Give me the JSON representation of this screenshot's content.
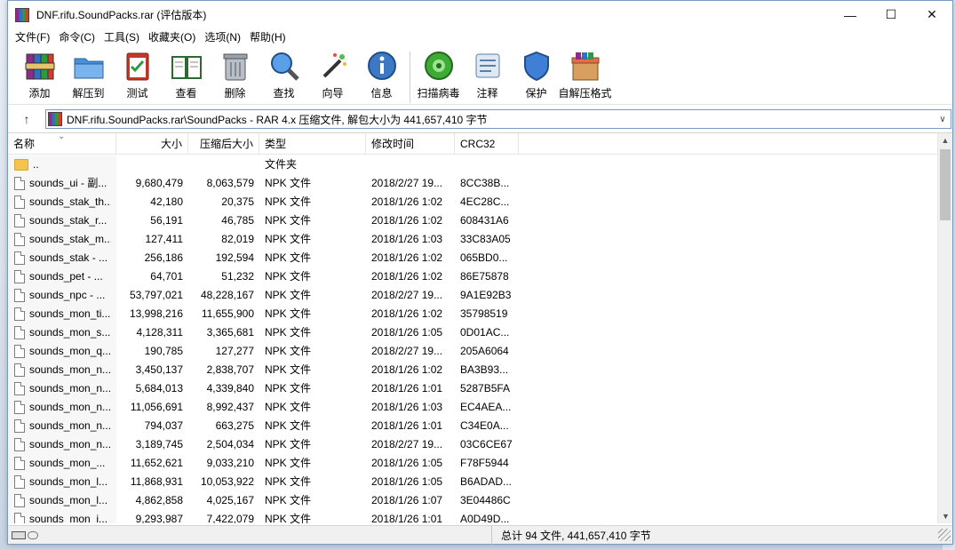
{
  "window": {
    "title": "DNF.rifu.SoundPacks.rar (评估版本)",
    "minimize_glyph": "—",
    "maximize_glyph": "☐",
    "close_glyph": "✕"
  },
  "menu": [
    "文件(F)",
    "命令(C)",
    "工具(S)",
    "收藏夹(O)",
    "选项(N)",
    "帮助(H)"
  ],
  "toolbar": {
    "add": "添加",
    "extract": "解压到",
    "test": "测试",
    "view": "查看",
    "delete": "删除",
    "find": "查找",
    "wizard": "向导",
    "info": "信息",
    "scan": "扫描病毒",
    "comment": "注释",
    "protect": "保护",
    "sfx": "自解压格式"
  },
  "address": {
    "up_glyph": "↑",
    "path": "DNF.rifu.SoundPacks.rar\\SoundPacks - RAR 4.x 压缩文件, 解包大小为 441,657,410 字节",
    "dropdown_glyph": "∨"
  },
  "columns": {
    "name": "名称",
    "size": "大小",
    "packed": "压缩后大小",
    "type": "类型",
    "mtime": "修改时间",
    "crc": "CRC32"
  },
  "rows": [
    {
      "kind": "folder",
      "name": "..",
      "size": "",
      "packed": "",
      "type": "文件夹",
      "mtime": "",
      "crc": ""
    },
    {
      "kind": "file",
      "name": "sounds_ui - 副...",
      "size": "9,680,479",
      "packed": "8,063,579",
      "type": "NPK 文件",
      "mtime": "2018/2/27 19...",
      "crc": "8CC38B..."
    },
    {
      "kind": "file",
      "name": "sounds_stak_th...",
      "size": "42,180",
      "packed": "20,375",
      "type": "NPK 文件",
      "mtime": "2018/1/26 1:02",
      "crc": "4EC28C..."
    },
    {
      "kind": "file",
      "name": "sounds_stak_r...",
      "size": "56,191",
      "packed": "46,785",
      "type": "NPK 文件",
      "mtime": "2018/1/26 1:02",
      "crc": "608431A6"
    },
    {
      "kind": "file",
      "name": "sounds_stak_m...",
      "size": "127,411",
      "packed": "82,019",
      "type": "NPK 文件",
      "mtime": "2018/1/26 1:03",
      "crc": "33C83A05"
    },
    {
      "kind": "file",
      "name": "sounds_stak - ...",
      "size": "256,186",
      "packed": "192,594",
      "type": "NPK 文件",
      "mtime": "2018/1/26 1:02",
      "crc": "065BD0..."
    },
    {
      "kind": "file",
      "name": "sounds_pet - ...",
      "size": "64,701",
      "packed": "51,232",
      "type": "NPK 文件",
      "mtime": "2018/1/26 1:02",
      "crc": "86E75878"
    },
    {
      "kind": "file",
      "name": "sounds_npc - ...",
      "size": "53,797,021",
      "packed": "48,228,167",
      "type": "NPK 文件",
      "mtime": "2018/2/27 19...",
      "crc": "9A1E92B3"
    },
    {
      "kind": "file",
      "name": "sounds_mon_ti...",
      "size": "13,998,216",
      "packed": "11,655,900",
      "type": "NPK 文件",
      "mtime": "2018/1/26 1:02",
      "crc": "35798519"
    },
    {
      "kind": "file",
      "name": "sounds_mon_s...",
      "size": "4,128,311",
      "packed": "3,365,681",
      "type": "NPK 文件",
      "mtime": "2018/1/26 1:05",
      "crc": "0D01AC..."
    },
    {
      "kind": "file",
      "name": "sounds_mon_q...",
      "size": "190,785",
      "packed": "127,277",
      "type": "NPK 文件",
      "mtime": "2018/2/27 19...",
      "crc": "205A6064"
    },
    {
      "kind": "file",
      "name": "sounds_mon_n...",
      "size": "3,450,137",
      "packed": "2,838,707",
      "type": "NPK 文件",
      "mtime": "2018/1/26 1:02",
      "crc": "BA3B93..."
    },
    {
      "kind": "file",
      "name": "sounds_mon_n...",
      "size": "5,684,013",
      "packed": "4,339,840",
      "type": "NPK 文件",
      "mtime": "2018/1/26 1:01",
      "crc": "5287B5FA"
    },
    {
      "kind": "file",
      "name": "sounds_mon_n...",
      "size": "11,056,691",
      "packed": "8,992,437",
      "type": "NPK 文件",
      "mtime": "2018/1/26 1:03",
      "crc": "EC4AEA..."
    },
    {
      "kind": "file",
      "name": "sounds_mon_n...",
      "size": "794,037",
      "packed": "663,275",
      "type": "NPK 文件",
      "mtime": "2018/1/26 1:01",
      "crc": "C34E0A..."
    },
    {
      "kind": "file",
      "name": "sounds_mon_n...",
      "size": "3,189,745",
      "packed": "2,504,034",
      "type": "NPK 文件",
      "mtime": "2018/2/27 19...",
      "crc": "03C6CE67"
    },
    {
      "kind": "file",
      "name": "sounds_mon_...",
      "size": "11,652,621",
      "packed": "9,033,210",
      "type": "NPK 文件",
      "mtime": "2018/1/26 1:05",
      "crc": "F78F5944"
    },
    {
      "kind": "file",
      "name": "sounds_mon_l...",
      "size": "11,868,931",
      "packed": "10,053,922",
      "type": "NPK 文件",
      "mtime": "2018/1/26 1:05",
      "crc": "B6ADAD..."
    },
    {
      "kind": "file",
      "name": "sounds_mon_l...",
      "size": "4,862,858",
      "packed": "4,025,167",
      "type": "NPK 文件",
      "mtime": "2018/1/26 1:07",
      "crc": "3E04486C"
    },
    {
      "kind": "file",
      "name": "sounds_mon_i...",
      "size": "9,293,987",
      "packed": "7,422,079",
      "type": "NPK 文件",
      "mtime": "2018/1/26 1:01",
      "crc": "A0D49D..."
    }
  ],
  "status": {
    "summary": "总计 94 文件, 441,657,410 字节"
  }
}
